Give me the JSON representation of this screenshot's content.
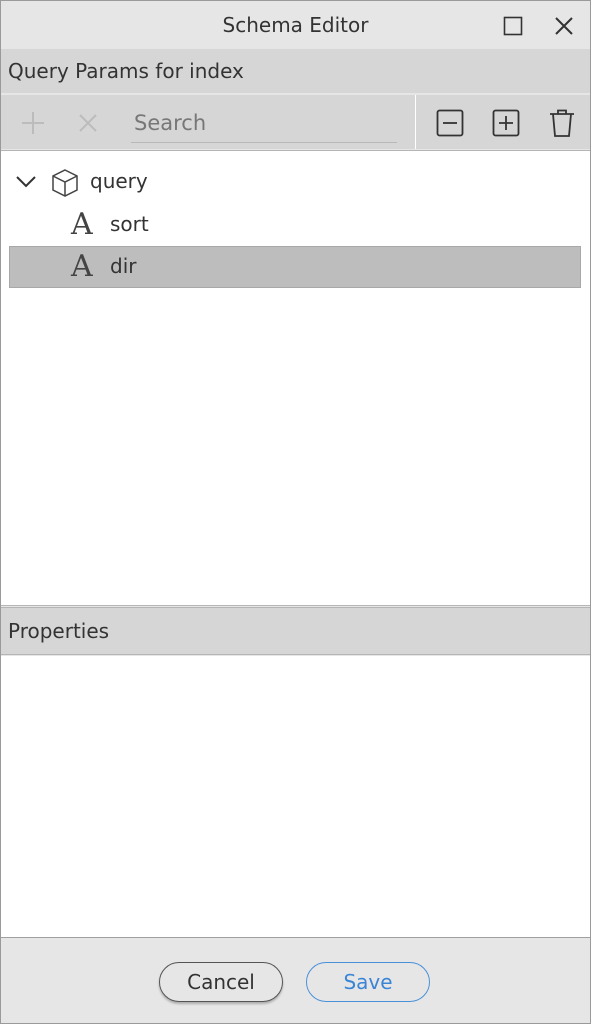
{
  "window": {
    "title": "Schema Editor",
    "maximize_icon": "square-icon",
    "close_icon": "close-icon"
  },
  "query_section": {
    "header": "Query Params for index"
  },
  "toolbar": {
    "add_icon": "plus-icon",
    "remove_icon": "x-icon",
    "search_placeholder": "Search",
    "search_value": "",
    "collapse_all_icon": "minus-square-icon",
    "expand_all_icon": "plus-square-icon",
    "delete_icon": "trash-icon"
  },
  "tree": {
    "root": {
      "label": "query",
      "expanded": true,
      "icon": "cube-icon",
      "children": [
        {
          "label": "sort",
          "type_glyph": "A",
          "icon": "string-type-icon",
          "selected": false
        },
        {
          "label": "dir",
          "type_glyph": "A",
          "icon": "string-type-icon",
          "selected": true
        }
      ]
    }
  },
  "properties_section": {
    "header": "Properties"
  },
  "footer": {
    "cancel_label": "Cancel",
    "save_label": "Save"
  },
  "colors": {
    "title_bg": "#e6e6e6",
    "header_bg": "#d6d6d6",
    "selected_row_bg": "#bdbdbd",
    "accent_blue": "#3a85d6"
  }
}
